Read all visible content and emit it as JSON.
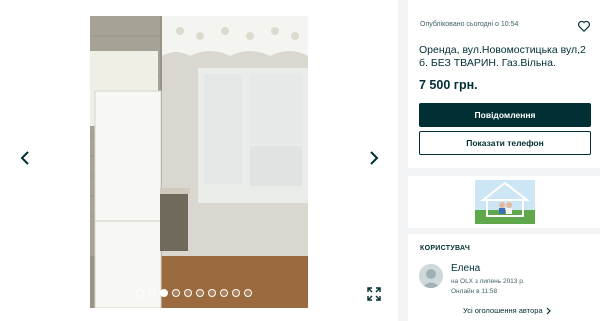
{
  "gallery": {
    "dots_total": 10,
    "dots_active": 2,
    "prev_icon": "chevron-left-icon",
    "next_icon": "chevron-right-icon",
    "expand_icon": "expand-icon"
  },
  "listing": {
    "posted": "Опубліковано сьогодні о 10:54",
    "title": "Оренда, вул.Новомостицька вул,2 б. БЕЗ ТВАРИН. Газ.Вільна.",
    "price": "7 500 грн.",
    "message_button": "Повідомлення",
    "phone_button": "Показати телефон",
    "favorite_icon": "heart-outline-icon"
  },
  "user": {
    "heading": "КОРИСТУВАЧ",
    "name": "Елена",
    "since": "на OLX з липень 2013 р.",
    "online": "Онлайн в 11:58",
    "all_ads": "Усі оголошення автора"
  },
  "colors": {
    "primary": "#002f34",
    "background": "#f2f4f5",
    "card": "#ffffff"
  }
}
